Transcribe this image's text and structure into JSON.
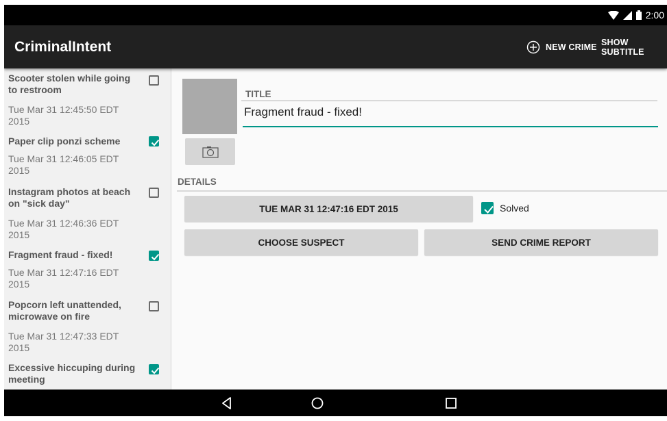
{
  "status_bar": {
    "time": "2:00",
    "icons": [
      "wifi-icon",
      "signal-icon",
      "battery-icon"
    ]
  },
  "app_bar": {
    "title": "CriminalIntent",
    "actions": [
      {
        "label": "NEW CRIME",
        "icon": "add-circle-icon"
      },
      {
        "label": "SHOW SUBTITLE"
      }
    ]
  },
  "crimes": [
    {
      "title": "Scooter stolen while going to restroom",
      "date": "Tue Mar 31 12:45:50 EDT 2015",
      "solved": false
    },
    {
      "title": "Paper clip ponzi scheme",
      "date": "Tue Mar 31 12:46:05 EDT 2015",
      "solved": true
    },
    {
      "title": "Instagram photos at beach on \"sick day\"",
      "date": "Tue Mar 31 12:46:36 EDT 2015",
      "solved": false
    },
    {
      "title": "Fragment fraud - fixed!",
      "date": "Tue Mar 31 12:47:16 EDT 2015",
      "solved": true
    },
    {
      "title": "Popcorn left unattended, microwave on fire",
      "date": "Tue Mar 31 12:47:33 EDT 2015",
      "solved": false
    },
    {
      "title": "Excessive hiccuping during meeting",
      "date": "",
      "solved": true
    }
  ],
  "detail": {
    "title_label": "TITLE",
    "title_value": "Fragment fraud - fixed!",
    "details_label": "DETAILS",
    "date_button": "TUE MAR 31 12:47:16 EDT 2015",
    "solved_label": "Solved",
    "solved": true,
    "choose_suspect": "CHOOSE SUSPECT",
    "send_report": "SEND CRIME REPORT"
  },
  "nav_bar": {
    "buttons": [
      "back-icon",
      "home-icon",
      "recents-icon"
    ]
  },
  "colors": {
    "accent": "#009688",
    "app_bar": "#212121",
    "button": "#d6d6d6"
  }
}
